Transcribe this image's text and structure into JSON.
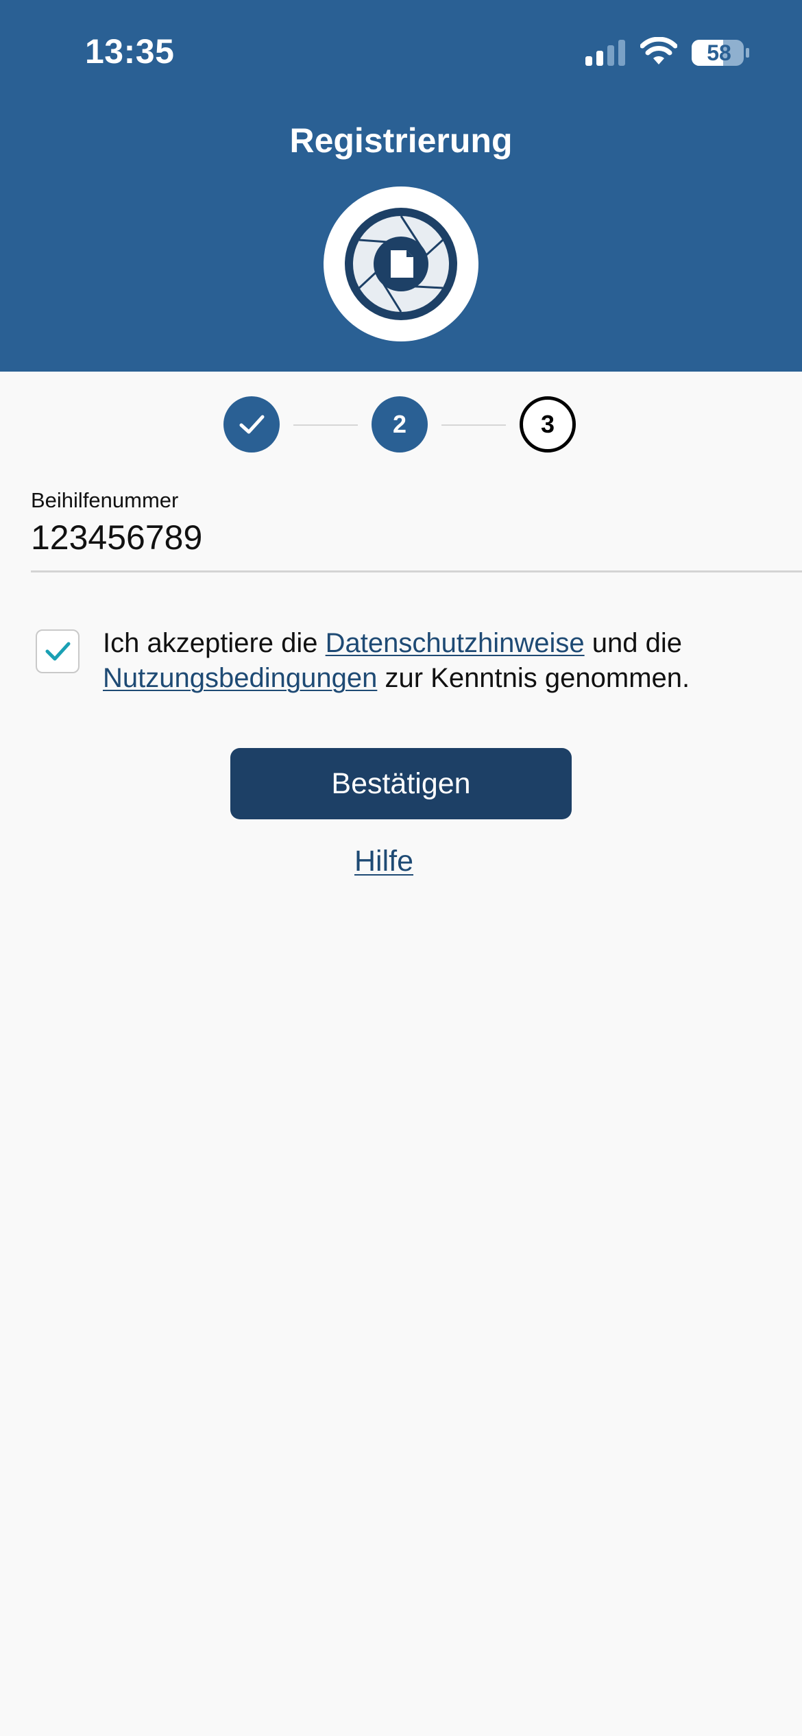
{
  "status_bar": {
    "time": "13:35",
    "battery": "58",
    "icons": [
      "signal-icon",
      "wifi-icon",
      "battery-icon"
    ]
  },
  "header": {
    "title": "Registrierung",
    "logo_icon": "camera-aperture-document-icon"
  },
  "stepper": {
    "steps": [
      {
        "label": "",
        "state": "completed",
        "icon": "checkmark-icon"
      },
      {
        "label": "2",
        "state": "active"
      },
      {
        "label": "3",
        "state": "upcoming"
      }
    ]
  },
  "form": {
    "field_label": "Beihilfenummer",
    "field_value": "123456789",
    "consent": {
      "checked": true,
      "text_1": "Ich akzeptiere die ",
      "link_privacy": "Datenschutzhinweise",
      "text_2": " und die ",
      "link_terms": "Nutzungsbedingungen",
      "text_3": " zur Kenntnis genommen."
    },
    "confirm_label": "Bestätigen",
    "help_label": "Hilfe"
  },
  "colors": {
    "header_bg": "#2a6094",
    "button_bg": "#1d4066",
    "link": "#1e4a74",
    "check_accent": "#1aa0b4",
    "page_bg": "#f9f9f9"
  }
}
